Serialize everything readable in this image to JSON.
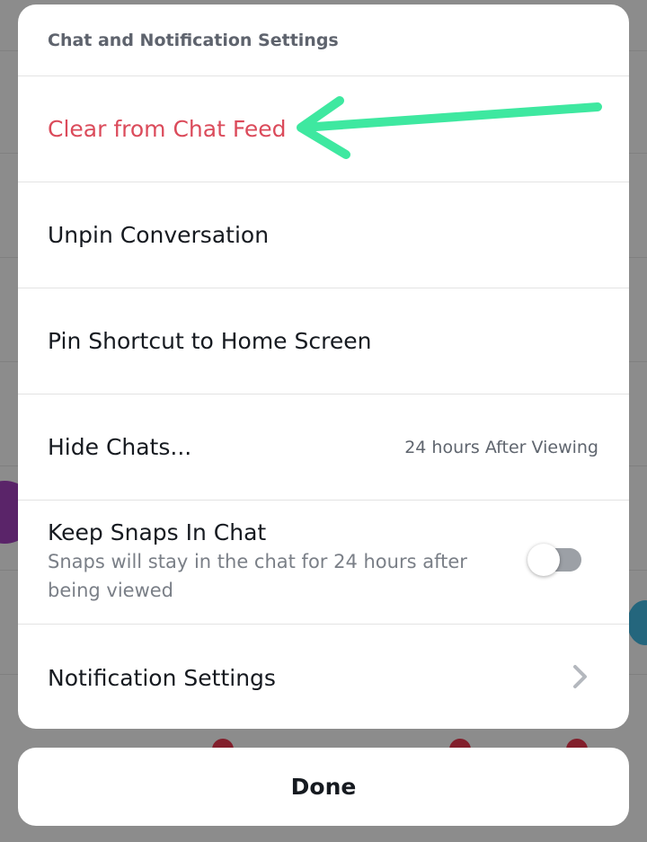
{
  "sheet": {
    "title": "Chat and Notification Settings",
    "items": [
      {
        "label": "Clear from Chat Feed"
      },
      {
        "label": "Unpin Conversation"
      },
      {
        "label": "Pin Shortcut to Home Screen"
      },
      {
        "label": "Hide Chats...",
        "value": "24 hours After Viewing"
      },
      {
        "label": "Keep Snaps In Chat",
        "description": "Snaps will stay in the chat for 24 hours after being viewed",
        "toggle_on": false
      },
      {
        "label": "Notification Settings"
      }
    ]
  },
  "done_label": "Done",
  "colors": {
    "danger": "#db4b5b",
    "annotation_arrow": "#3ee8a0"
  }
}
